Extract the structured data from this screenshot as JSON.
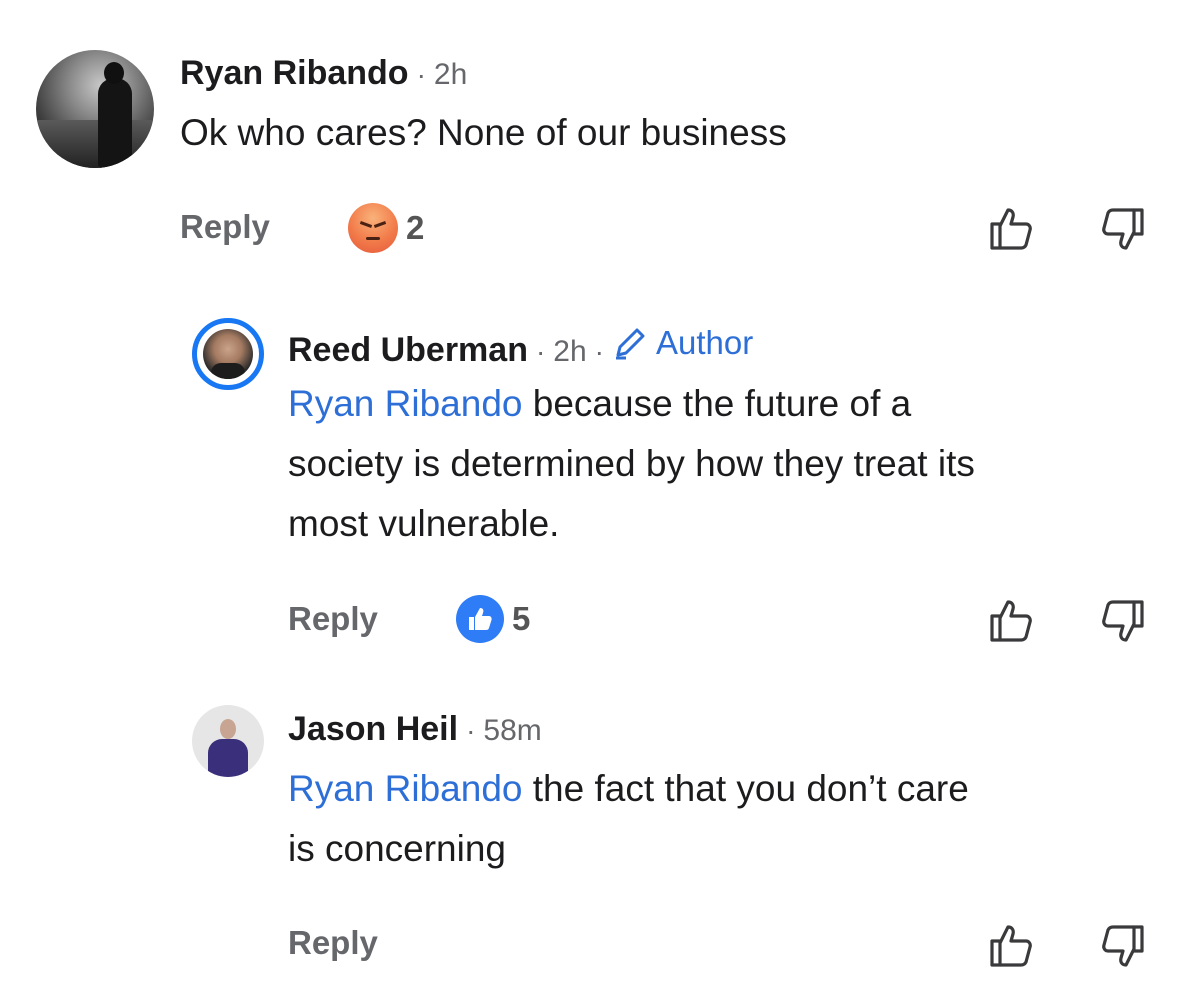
{
  "comments": [
    {
      "name": "Ryan Ribando",
      "separator": "·",
      "time": "2h",
      "text": "Ok who cares? None of our business",
      "reply_label": "Reply",
      "reaction": {
        "icon": "angry-emoji-icon",
        "count": "2"
      }
    },
    {
      "name": "Reed Uberman",
      "separator": "·",
      "time": "2h",
      "separator2": "·",
      "badge": "Author",
      "mention": "Ryan Ribando",
      "text_line1": " because the future of a",
      "text_line2": "society is determined by how they treat its",
      "text_line3": "most vulnerable.",
      "reply_label": "Reply",
      "reaction": {
        "icon": "like-reaction-icon",
        "count": "5"
      }
    },
    {
      "name": "Jason Heil",
      "separator": "·",
      "time": "58m",
      "mention": "Ryan Ribando",
      "text_line1": " the fact that you don’t care",
      "text_line2": "is concerning",
      "reply_label": "Reply"
    }
  ],
  "colors": {
    "accent": "#2d6fd6",
    "like_blue": "#2e7cf6",
    "muted": "#65676b",
    "ring": "#1877f2"
  }
}
